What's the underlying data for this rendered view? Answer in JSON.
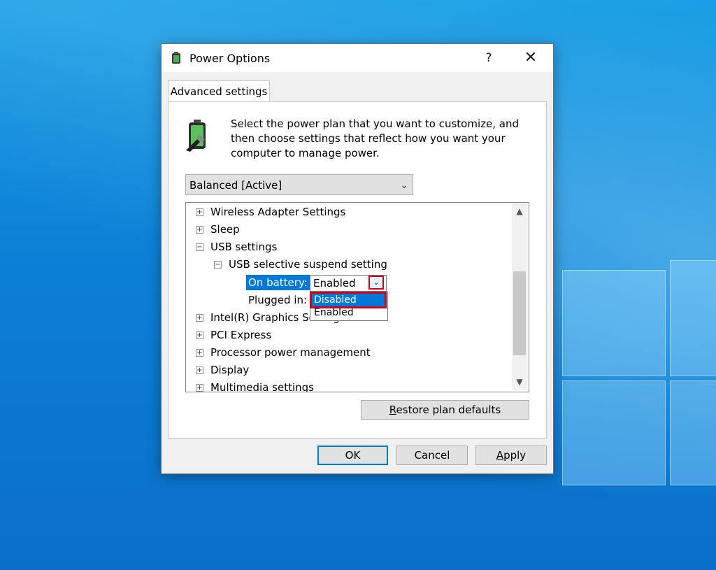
{
  "window": {
    "title": "Power Options",
    "help": "?",
    "close": "✕"
  },
  "tab": {
    "label": "Advanced settings"
  },
  "description": "Select the power plan that you want to customize, and then choose settings that reflect how you want your computer to manage power.",
  "plan_select": {
    "value": "Balanced [Active]"
  },
  "tree": {
    "items": [
      {
        "label": "Wireless Adapter Settings",
        "expander": "+"
      },
      {
        "label": "Sleep",
        "expander": "+"
      },
      {
        "label": "USB settings",
        "expander": "−"
      },
      {
        "label": "USB selective suspend setting",
        "expander": "−"
      },
      {
        "label": "On battery:"
      },
      {
        "label": "Plugged in:"
      },
      {
        "label": "Intel(R) Graphics Settings",
        "expander": "+"
      },
      {
        "label": "PCI Express",
        "expander": "+"
      },
      {
        "label": "Processor power management",
        "expander": "+"
      },
      {
        "label": "Display",
        "expander": "+"
      },
      {
        "label": "Multimedia settings",
        "expander": "+"
      }
    ],
    "combo_value": "Enabled",
    "dropdown_options": [
      "Disabled",
      "Enabled"
    ]
  },
  "buttons": {
    "restore_first": "R",
    "restore_rest": "estore plan defaults",
    "ok": "OK",
    "cancel": "Cancel",
    "apply_first": "A",
    "apply_rest": "pply"
  },
  "colors": {
    "accent": "#0078d7",
    "highlight_border": "#d0021b"
  }
}
